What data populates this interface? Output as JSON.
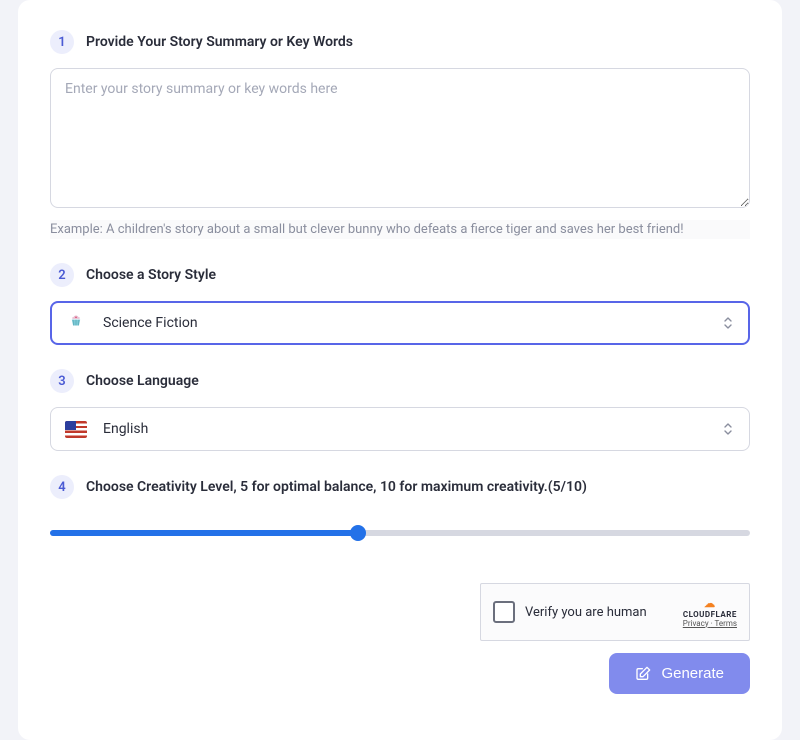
{
  "step1": {
    "number": "1",
    "title": "Provide Your Story Summary or Key Words",
    "placeholder": "Enter your story summary or key words here",
    "example_label": "Example:  ",
    "example_text": "A children's story about a small but clever bunny who defeats a fierce tiger and saves her best friend!"
  },
  "step2": {
    "number": "2",
    "title": "Choose a Story Style",
    "selected": "Science Fiction",
    "icon": "cupcake-icon"
  },
  "step3": {
    "number": "3",
    "title": "Choose Language",
    "selected": "English",
    "icon": "flag-us-icon"
  },
  "step4": {
    "number": "4",
    "title": "Choose Creativity Level, 5 for optimal balance, 10 for maximum creativity.(5/10)",
    "value": 5,
    "max": 10
  },
  "captcha": {
    "label": "Verify you are human",
    "brand": "CLOUDFLARE",
    "privacy": "Privacy",
    "terms": "Terms"
  },
  "generate": {
    "label": "Generate"
  }
}
